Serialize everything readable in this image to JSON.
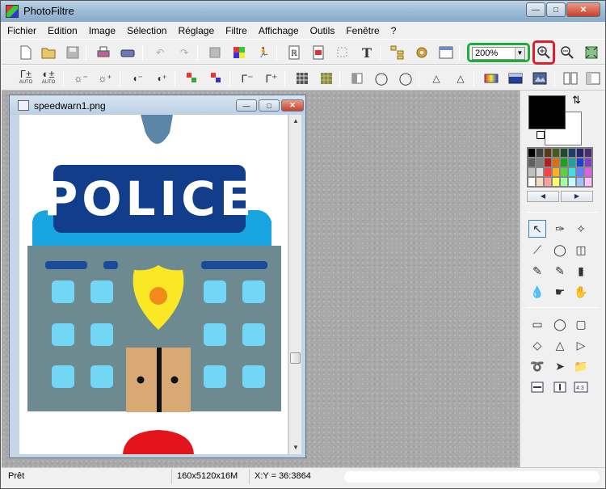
{
  "app": {
    "title": "PhotoFiltre"
  },
  "menu": [
    "Fichier",
    "Edition",
    "Image",
    "Sélection",
    "Réglage",
    "Filtre",
    "Affichage",
    "Outils",
    "Fenêtre",
    "?"
  ],
  "toolbar": {
    "zoom_value": "200%"
  },
  "toolbar2": {
    "auto1": "AUTO",
    "auto2": "AUTO"
  },
  "document": {
    "filename": "speedwarn1.png",
    "sign_text": "POLICE"
  },
  "status": {
    "state": "Prêt",
    "image_info": "160x5120x16M",
    "coords": "X:Y = 36:3864"
  },
  "colors": {
    "highlight_green": "#1fae3a",
    "highlight_red": "#e01e2a",
    "foreground": "#000000",
    "background": "#ffffff"
  },
  "palette": [
    "#000000",
    "#404040",
    "#5a3a1a",
    "#4b5a20",
    "#1b4b2c",
    "#1c3c6c",
    "#25256e",
    "#4b2c6c",
    "#606060",
    "#808080",
    "#b02020",
    "#d87010",
    "#20a020",
    "#20a0a0",
    "#2040d0",
    "#8040c0",
    "#c0c0c0",
    "#e0e0e0",
    "#ff4040",
    "#ffb020",
    "#60d040",
    "#40e0e0",
    "#6080ff",
    "#e060e0",
    "#ffffff",
    "#f0e0c0",
    "#ffa0a0",
    "#ffff60",
    "#a0ffa0",
    "#c0ffff",
    "#a0c0ff",
    "#ffc0ff"
  ]
}
